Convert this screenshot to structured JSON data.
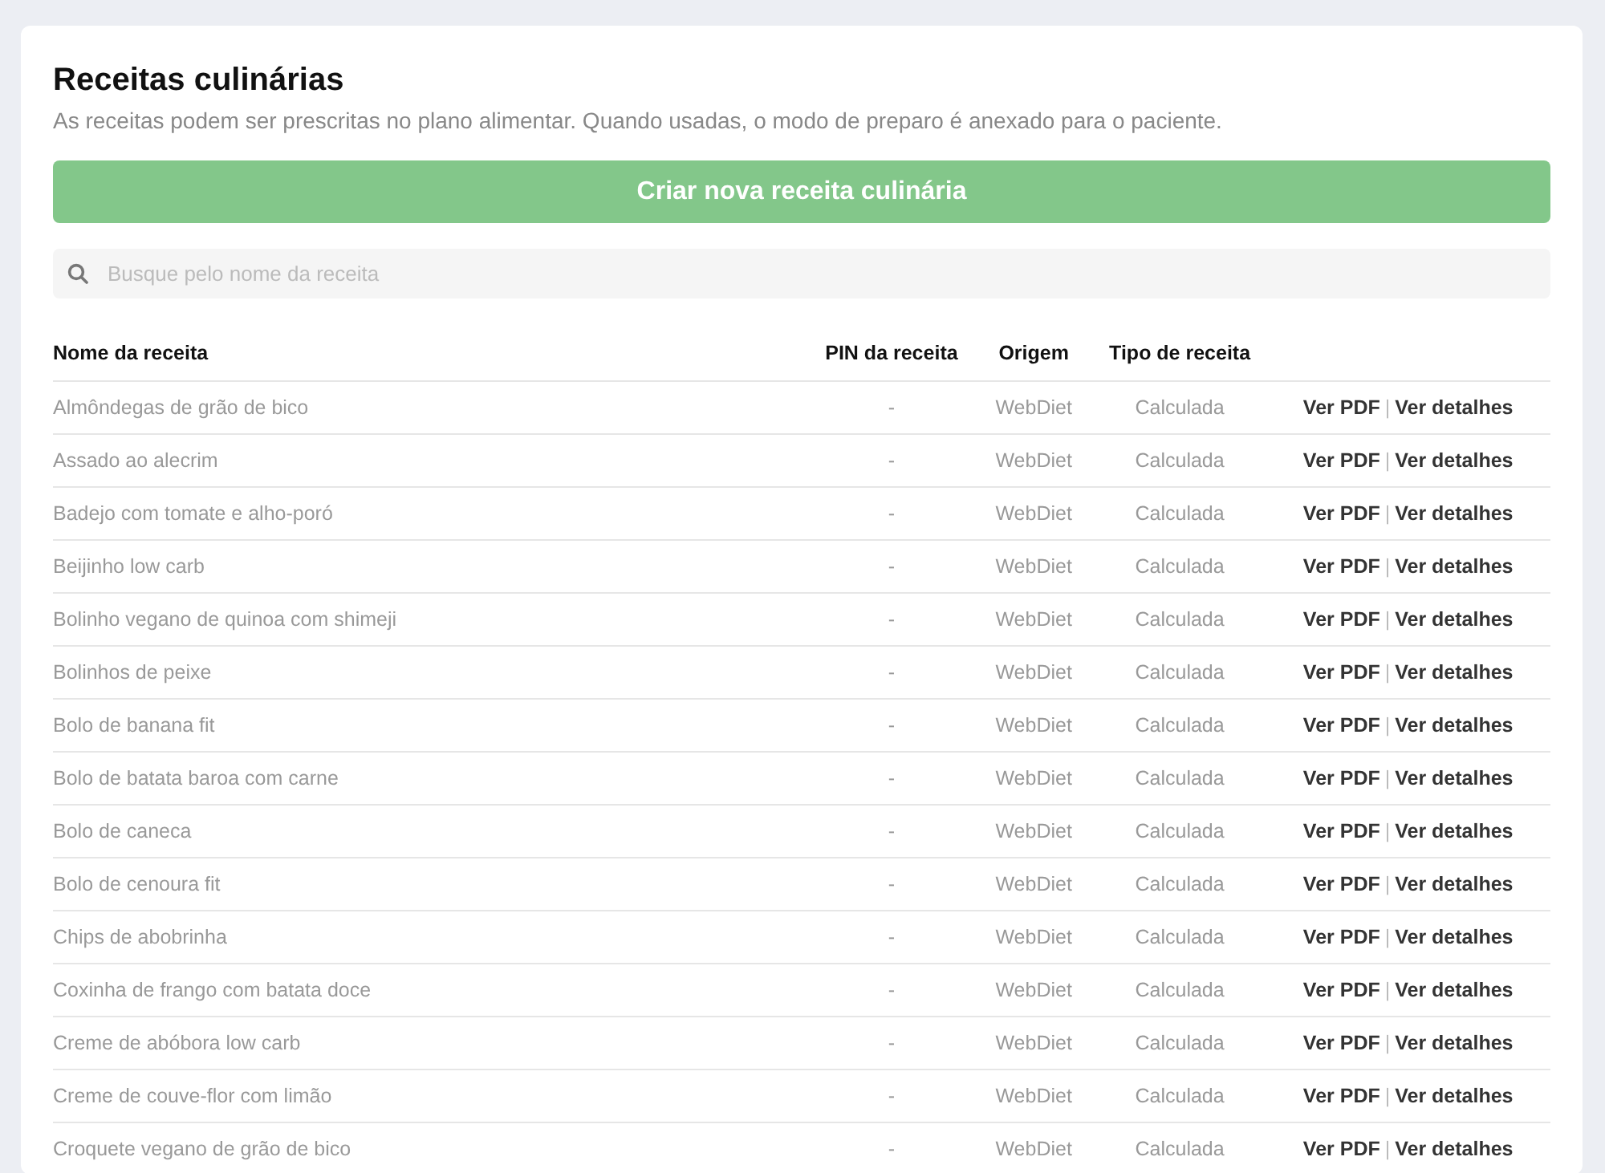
{
  "page": {
    "title": "Receitas culinárias",
    "subtitle": "As receitas podem ser prescritas no plano alimentar. Quando usadas, o modo de preparo é anexado para o paciente."
  },
  "create_button": {
    "label": "Criar nova receita culinária"
  },
  "search": {
    "placeholder": "Busque pelo nome da receita"
  },
  "table": {
    "columns": [
      "Nome da receita",
      "PIN da receita",
      "Origem",
      "Tipo de receita"
    ],
    "rows": [
      {
        "name": "Almôndegas de grão de bico",
        "pin": "-",
        "origin": "WebDiet",
        "type": "Calculada",
        "actions": [
          "Ver PDF",
          "Ver detalhes"
        ],
        "separator": "|"
      },
      {
        "name": "Assado ao alecrim",
        "pin": "-",
        "origin": "WebDiet",
        "type": "Calculada",
        "actions": [
          "Ver PDF",
          "Ver detalhes"
        ],
        "separator": "|"
      },
      {
        "name": "Badejo com tomate e alho-poró",
        "pin": "-",
        "origin": "WebDiet",
        "type": "Calculada",
        "actions": [
          "Ver PDF",
          "Ver detalhes"
        ],
        "separator": "|"
      },
      {
        "name": "Beijinho low carb",
        "pin": "-",
        "origin": "WebDiet",
        "type": "Calculada",
        "actions": [
          "Ver PDF",
          "Ver detalhes"
        ],
        "separator": "|"
      },
      {
        "name": "Bolinho vegano de quinoa com shimeji",
        "pin": "-",
        "origin": "WebDiet",
        "type": "Calculada",
        "actions": [
          "Ver PDF",
          "Ver detalhes"
        ],
        "separator": "|"
      },
      {
        "name": "Bolinhos de peixe",
        "pin": "-",
        "origin": "WebDiet",
        "type": "Calculada",
        "actions": [
          "Ver PDF",
          "Ver detalhes"
        ],
        "separator": "|"
      },
      {
        "name": "Bolo de banana fit",
        "pin": "-",
        "origin": "WebDiet",
        "type": "Calculada",
        "actions": [
          "Ver PDF",
          "Ver detalhes"
        ],
        "separator": "|"
      },
      {
        "name": "Bolo de batata baroa com carne",
        "pin": "-",
        "origin": "WebDiet",
        "type": "Calculada",
        "actions": [
          "Ver PDF",
          "Ver detalhes"
        ],
        "separator": "|"
      },
      {
        "name": "Bolo de caneca",
        "pin": "-",
        "origin": "WebDiet",
        "type": "Calculada",
        "actions": [
          "Ver PDF",
          "Ver detalhes"
        ],
        "separator": "|"
      },
      {
        "name": "Bolo de cenoura fit",
        "pin": "-",
        "origin": "WebDiet",
        "type": "Calculada",
        "actions": [
          "Ver PDF",
          "Ver detalhes"
        ],
        "separator": "|"
      },
      {
        "name": "Chips de abobrinha",
        "pin": "-",
        "origin": "WebDiet",
        "type": "Calculada",
        "actions": [
          "Ver PDF",
          "Ver detalhes"
        ],
        "separator": "|"
      },
      {
        "name": "Coxinha de frango com batata doce",
        "pin": "-",
        "origin": "WebDiet",
        "type": "Calculada",
        "actions": [
          "Ver PDF",
          "Ver detalhes"
        ],
        "separator": "|"
      },
      {
        "name": "Creme de abóbora low carb",
        "pin": "-",
        "origin": "WebDiet",
        "type": "Calculada",
        "actions": [
          "Ver PDF",
          "Ver detalhes"
        ],
        "separator": "|"
      },
      {
        "name": "Creme de couve-flor com limão",
        "pin": "-",
        "origin": "WebDiet",
        "type": "Calculada",
        "actions": [
          "Ver PDF",
          "Ver detalhes"
        ],
        "separator": "|"
      },
      {
        "name": "Croquete vegano de grão de bico",
        "pin": "-",
        "origin": "WebDiet",
        "type": "Calculada",
        "actions": [
          "Ver PDF",
          "Ver detalhes"
        ],
        "separator": "|"
      }
    ]
  }
}
